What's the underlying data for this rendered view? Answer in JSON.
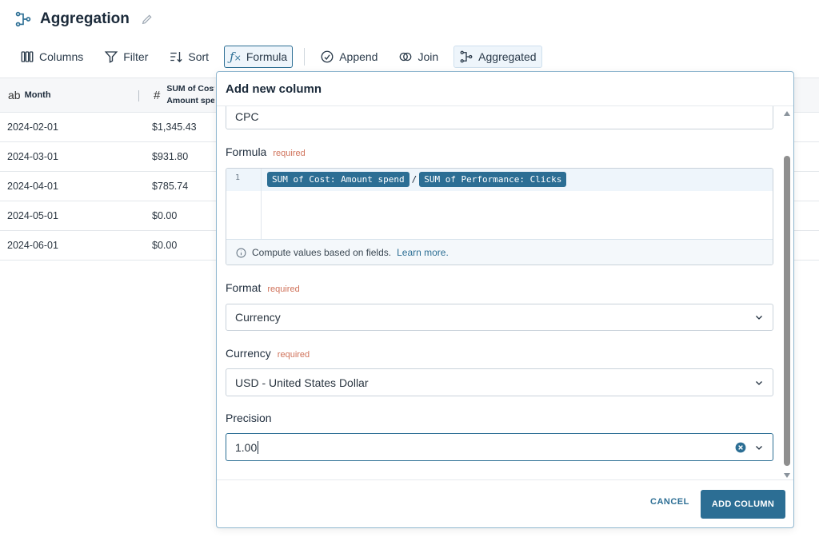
{
  "header": {
    "title": "Aggregation"
  },
  "toolbar": {
    "columns": "Columns",
    "filter": "Filter",
    "sort": "Sort",
    "formula": "Formula",
    "append": "Append",
    "join": "Join",
    "aggregated": "Aggregated"
  },
  "table": {
    "headers": {
      "month_type": "ab",
      "month": "Month",
      "sum_type": "#",
      "sum_line1": "SUM of Cost:",
      "sum_line2": "Amount spend"
    },
    "rows": [
      {
        "month": "2024-02-01",
        "value": "$1,345.43"
      },
      {
        "month": "2024-03-01",
        "value": "$931.80"
      },
      {
        "month": "2024-04-01",
        "value": "$785.74"
      },
      {
        "month": "2024-05-01",
        "value": "$0.00"
      },
      {
        "month": "2024-06-01",
        "value": "$0.00"
      }
    ]
  },
  "panel": {
    "title": "Add new column",
    "name_value": "CPC",
    "formula": {
      "label": "Formula",
      "required": "required",
      "line_number": "1",
      "field1": "SUM of Cost: Amount spend",
      "operator": "/",
      "field2": "SUM of Performance: Clicks",
      "hint": "Compute values based on fields.",
      "learn_more": "Learn more."
    },
    "format": {
      "label": "Format",
      "required": "required",
      "value": "Currency"
    },
    "currency": {
      "label": "Currency",
      "required": "required",
      "value": "USD - United States Dollar"
    },
    "precision": {
      "label": "Precision",
      "value": "1.00"
    },
    "cancel": "CANCEL",
    "add": "ADD COLUMN"
  }
}
